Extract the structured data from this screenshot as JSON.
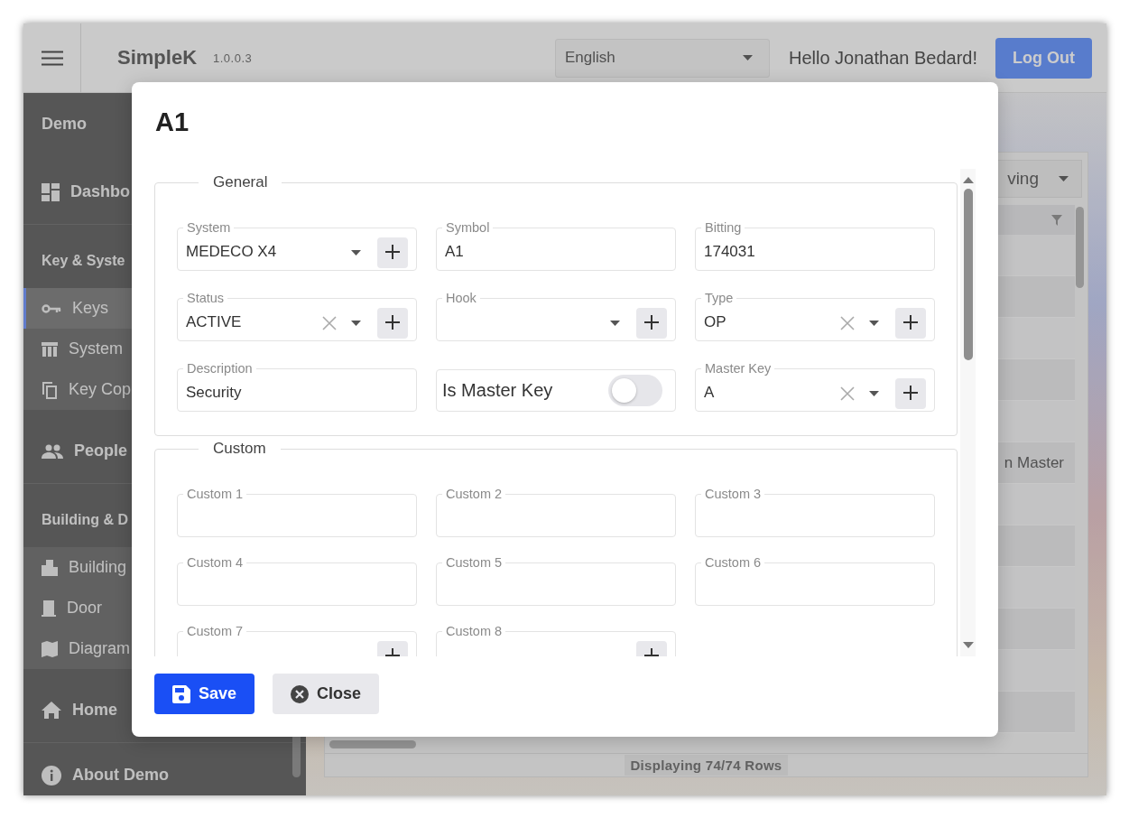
{
  "header": {
    "title": "SimpleK",
    "version": "1.0.0.3",
    "language": "English",
    "greeting": "Hello Jonathan Bedard!",
    "logout": "Log Out"
  },
  "sidebar": {
    "items": [
      {
        "kind": "title",
        "label": "Demo"
      },
      {
        "kind": "link",
        "label": "Dashbo",
        "selected": false
      },
      {
        "kind": "heading",
        "label": "Key & Syste"
      },
      {
        "kind": "sub",
        "label": "Keys",
        "selected": true
      },
      {
        "kind": "sub",
        "label": "System",
        "selected": false
      },
      {
        "kind": "sub",
        "label": "Key Cop",
        "selected": false
      },
      {
        "kind": "link",
        "label": "People",
        "selected": false
      },
      {
        "kind": "heading",
        "label": "Building & D"
      },
      {
        "kind": "sub",
        "label": "Building",
        "selected": false
      },
      {
        "kind": "sub",
        "label": "Door",
        "selected": false
      },
      {
        "kind": "sub",
        "label": "Diagram",
        "selected": false
      },
      {
        "kind": "link",
        "label": "Home",
        "selected": false
      },
      {
        "kind": "link",
        "label": "About Demo",
        "selected": false
      }
    ]
  },
  "main": {
    "view_select": "ving",
    "partial_cell": "n Master",
    "status": "Displaying 74/74 Rows"
  },
  "dialog": {
    "title": "A1",
    "sections": [
      {
        "legend": "General",
        "fields": [
          {
            "kind": "select",
            "label": "System",
            "value": "MEDECO X4",
            "clearable": false,
            "add": true
          },
          {
            "kind": "select",
            "label": "Status",
            "value": "ACTIVE",
            "clearable": true,
            "add": true
          },
          {
            "kind": "text",
            "label": "Description",
            "value": "Security",
            "add": false
          },
          {
            "kind": "text",
            "label": "Symbol",
            "value": "A1",
            "add": false
          },
          {
            "kind": "select",
            "label": "Hook",
            "clearable": false,
            "add": true
          },
          {
            "kind": "toggle",
            "label": "Is Master Key",
            "on": false
          },
          {
            "kind": "text",
            "label": "Bitting",
            "value": "174031",
            "add": false
          },
          {
            "kind": "select",
            "label": "Type",
            "value": "OP",
            "clearable": true,
            "add": true
          },
          {
            "kind": "select",
            "label": "Master Key",
            "value": "A",
            "clearable": true,
            "add": true
          }
        ]
      },
      {
        "legend": "Custom",
        "fields": [
          {
            "kind": "text",
            "label": "Custom 1",
            "add": false
          },
          {
            "kind": "text",
            "label": "Custom 4",
            "add": false
          },
          {
            "kind": "text",
            "label": "Custom 7",
            "add": true
          },
          {
            "kind": "text",
            "label": "Custom 2",
            "add": false
          },
          {
            "kind": "text",
            "label": "Custom 5",
            "add": false
          },
          {
            "kind": "text",
            "label": "Custom 8",
            "add": true
          },
          {
            "kind": "text",
            "label": "Custom 3",
            "add": false
          },
          {
            "kind": "text",
            "label": "Custom 6",
            "add": false
          }
        ]
      }
    ],
    "buttons": [
      {
        "kind": "primary",
        "label": "Save"
      },
      {
        "kind": "secondary",
        "label": "Close"
      }
    ]
  }
}
